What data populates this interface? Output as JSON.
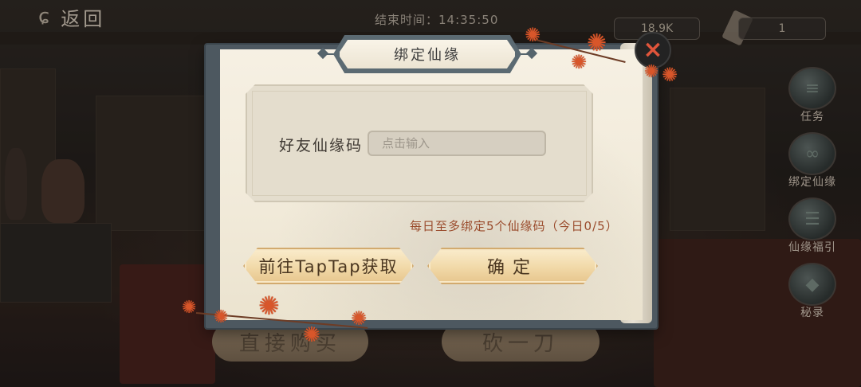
{
  "top_bar": {
    "back_label": "返回",
    "end_time": "结束时间：14:35:50",
    "resource_1": "18.9K",
    "resource_2": "1"
  },
  "side_menu": [
    {
      "label": "任务",
      "icon": "scroll-icon"
    },
    {
      "label": "绑定仙缘",
      "icon": "bind-icon"
    },
    {
      "label": "仙缘福引",
      "icon": "scroll-bundle-icon"
    },
    {
      "label": "秘录",
      "icon": "book-icon"
    }
  ],
  "bottom_buttons": {
    "buy_label": "直接购买",
    "cut_label": "砍一刀"
  },
  "dialog": {
    "title": "绑定仙缘",
    "field_label": "好友仙缘码",
    "field_value": "",
    "field_placeholder": "点击输入",
    "limit_text": "每日至多绑定5个仙缘码（今日0/5）",
    "goto_button": "前往TapTap获取",
    "confirm_button": "确定",
    "close_icon": "×"
  },
  "colors": {
    "accent_text": "#9a4b2c",
    "button_fill": "#f1d9a8",
    "frame": "#4d5860",
    "close_x": "#e0553b"
  }
}
